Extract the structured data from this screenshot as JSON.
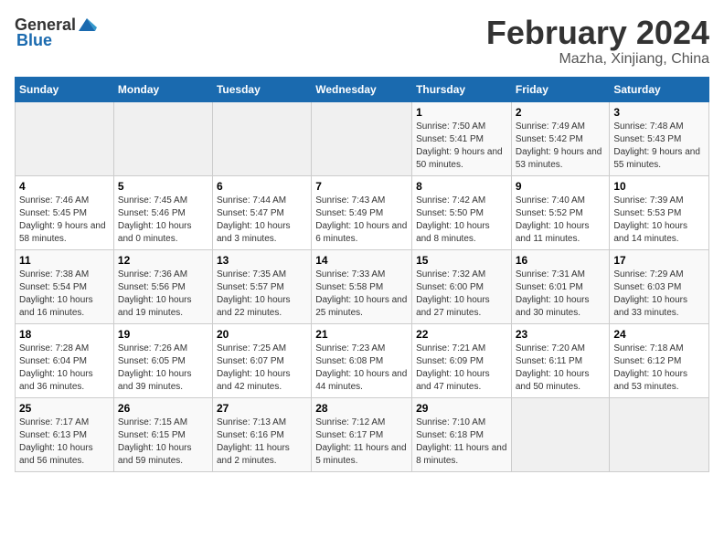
{
  "header": {
    "logo_general": "General",
    "logo_blue": "Blue",
    "title": "February 2024",
    "subtitle": "Mazha, Xinjiang, China"
  },
  "weekdays": [
    "Sunday",
    "Monday",
    "Tuesday",
    "Wednesday",
    "Thursday",
    "Friday",
    "Saturday"
  ],
  "weeks": [
    [
      {
        "num": "",
        "info": ""
      },
      {
        "num": "",
        "info": ""
      },
      {
        "num": "",
        "info": ""
      },
      {
        "num": "",
        "info": ""
      },
      {
        "num": "1",
        "info": "Sunrise: 7:50 AM\nSunset: 5:41 PM\nDaylight: 9 hours and 50 minutes."
      },
      {
        "num": "2",
        "info": "Sunrise: 7:49 AM\nSunset: 5:42 PM\nDaylight: 9 hours and 53 minutes."
      },
      {
        "num": "3",
        "info": "Sunrise: 7:48 AM\nSunset: 5:43 PM\nDaylight: 9 hours and 55 minutes."
      }
    ],
    [
      {
        "num": "4",
        "info": "Sunrise: 7:46 AM\nSunset: 5:45 PM\nDaylight: 9 hours and 58 minutes."
      },
      {
        "num": "5",
        "info": "Sunrise: 7:45 AM\nSunset: 5:46 PM\nDaylight: 10 hours and 0 minutes."
      },
      {
        "num": "6",
        "info": "Sunrise: 7:44 AM\nSunset: 5:47 PM\nDaylight: 10 hours and 3 minutes."
      },
      {
        "num": "7",
        "info": "Sunrise: 7:43 AM\nSunset: 5:49 PM\nDaylight: 10 hours and 6 minutes."
      },
      {
        "num": "8",
        "info": "Sunrise: 7:42 AM\nSunset: 5:50 PM\nDaylight: 10 hours and 8 minutes."
      },
      {
        "num": "9",
        "info": "Sunrise: 7:40 AM\nSunset: 5:52 PM\nDaylight: 10 hours and 11 minutes."
      },
      {
        "num": "10",
        "info": "Sunrise: 7:39 AM\nSunset: 5:53 PM\nDaylight: 10 hours and 14 minutes."
      }
    ],
    [
      {
        "num": "11",
        "info": "Sunrise: 7:38 AM\nSunset: 5:54 PM\nDaylight: 10 hours and 16 minutes."
      },
      {
        "num": "12",
        "info": "Sunrise: 7:36 AM\nSunset: 5:56 PM\nDaylight: 10 hours and 19 minutes."
      },
      {
        "num": "13",
        "info": "Sunrise: 7:35 AM\nSunset: 5:57 PM\nDaylight: 10 hours and 22 minutes."
      },
      {
        "num": "14",
        "info": "Sunrise: 7:33 AM\nSunset: 5:58 PM\nDaylight: 10 hours and 25 minutes."
      },
      {
        "num": "15",
        "info": "Sunrise: 7:32 AM\nSunset: 6:00 PM\nDaylight: 10 hours and 27 minutes."
      },
      {
        "num": "16",
        "info": "Sunrise: 7:31 AM\nSunset: 6:01 PM\nDaylight: 10 hours and 30 minutes."
      },
      {
        "num": "17",
        "info": "Sunrise: 7:29 AM\nSunset: 6:03 PM\nDaylight: 10 hours and 33 minutes."
      }
    ],
    [
      {
        "num": "18",
        "info": "Sunrise: 7:28 AM\nSunset: 6:04 PM\nDaylight: 10 hours and 36 minutes."
      },
      {
        "num": "19",
        "info": "Sunrise: 7:26 AM\nSunset: 6:05 PM\nDaylight: 10 hours and 39 minutes."
      },
      {
        "num": "20",
        "info": "Sunrise: 7:25 AM\nSunset: 6:07 PM\nDaylight: 10 hours and 42 minutes."
      },
      {
        "num": "21",
        "info": "Sunrise: 7:23 AM\nSunset: 6:08 PM\nDaylight: 10 hours and 44 minutes."
      },
      {
        "num": "22",
        "info": "Sunrise: 7:21 AM\nSunset: 6:09 PM\nDaylight: 10 hours and 47 minutes."
      },
      {
        "num": "23",
        "info": "Sunrise: 7:20 AM\nSunset: 6:11 PM\nDaylight: 10 hours and 50 minutes."
      },
      {
        "num": "24",
        "info": "Sunrise: 7:18 AM\nSunset: 6:12 PM\nDaylight: 10 hours and 53 minutes."
      }
    ],
    [
      {
        "num": "25",
        "info": "Sunrise: 7:17 AM\nSunset: 6:13 PM\nDaylight: 10 hours and 56 minutes."
      },
      {
        "num": "26",
        "info": "Sunrise: 7:15 AM\nSunset: 6:15 PM\nDaylight: 10 hours and 59 minutes."
      },
      {
        "num": "27",
        "info": "Sunrise: 7:13 AM\nSunset: 6:16 PM\nDaylight: 11 hours and 2 minutes."
      },
      {
        "num": "28",
        "info": "Sunrise: 7:12 AM\nSunset: 6:17 PM\nDaylight: 11 hours and 5 minutes."
      },
      {
        "num": "29",
        "info": "Sunrise: 7:10 AM\nSunset: 6:18 PM\nDaylight: 11 hours and 8 minutes."
      },
      {
        "num": "",
        "info": ""
      },
      {
        "num": "",
        "info": ""
      }
    ]
  ]
}
